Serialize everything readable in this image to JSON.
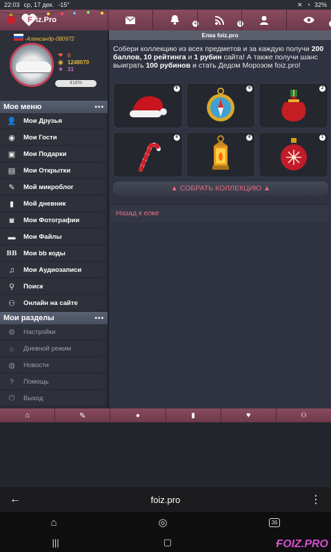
{
  "status_bar": {
    "time": "22:03",
    "date": "ср, 17 дек.",
    "temp": "-15°",
    "battery": "32%"
  },
  "app": {
    "logo_text": "iz.Pro",
    "logo_letter": "F"
  },
  "top_nav": {
    "items": [
      {
        "icon": "mail-icon",
        "badge": ""
      },
      {
        "icon": "bell-icon",
        "badge": "4"
      },
      {
        "icon": "rss-icon",
        "badge": "6"
      },
      {
        "icon": "user-icon",
        "badge": ""
      },
      {
        "icon": "eye-icon",
        "badge": "3"
      }
    ]
  },
  "profile": {
    "username": "-Александр-080972",
    "heart_count": "0",
    "coins": "1248070",
    "rating": "31",
    "progress_label": "416%",
    "progress_fraction": 1.0
  },
  "my_menu": {
    "title": "Мое меню",
    "items": [
      {
        "label": "Мои Друзья",
        "icon": "users-icon"
      },
      {
        "label": "Мои Гости",
        "icon": "eye-icon"
      },
      {
        "label": "Мои Подарки",
        "icon": "gift-icon"
      },
      {
        "label": "Мои Открытки",
        "icon": "postcard-icon"
      },
      {
        "label": "Мой микроблог",
        "icon": "edit-icon"
      },
      {
        "label": "Мой дневник",
        "icon": "book-icon"
      },
      {
        "label": "Мои Фотографии",
        "icon": "camera-icon"
      },
      {
        "label": "Мои Файлы",
        "icon": "folder-icon"
      },
      {
        "label": "Мои bb коды",
        "icon": "bb-icon"
      },
      {
        "label": "Мои Аудиозаписи",
        "icon": "music-icon"
      },
      {
        "label": "Поиск",
        "icon": "search-icon"
      },
      {
        "label": "Онлайн на сайте",
        "icon": "online-icon"
      }
    ]
  },
  "my_sections": {
    "title": "Мои разделы",
    "items": [
      {
        "label": "Настройки",
        "icon": "gear-icon"
      },
      {
        "label": "Дневной режим",
        "icon": "sun-icon"
      },
      {
        "label": "Новости",
        "icon": "globe-icon"
      },
      {
        "label": "Помощь",
        "icon": "help-icon"
      },
      {
        "label": "Выход",
        "icon": "power-icon"
      }
    ]
  },
  "main": {
    "title": "Елка foiz.pro",
    "desc_parts": {
      "a": "Собери коллекцию из всех предметов и за каждую получи ",
      "b": "200 баллов, 10 рейтинга",
      "c": " и ",
      "d": "1 рубин",
      "e": " сайта! А также получи шанс выиграть ",
      "f": "100 рубинов",
      "g": " и стать Дедом Морозом foiz.pro!"
    },
    "items": [
      {
        "name": "santa-hat",
        "count": "6"
      },
      {
        "name": "compass",
        "count": "6"
      },
      {
        "name": "gift-sack",
        "count": "2"
      },
      {
        "name": "candy-cane",
        "count": "4"
      },
      {
        "name": "lantern",
        "count": "6"
      },
      {
        "name": "ornament",
        "count": "1"
      }
    ],
    "collect_label": "СОБРАТЬ КОЛЛЕКЦИЮ",
    "back_label": "Назад к елке"
  },
  "bottom_nav": [
    "home-icon",
    "pencil-icon",
    "chat-icon",
    "book-icon",
    "heart-icon",
    "group-icon"
  ],
  "browser": {
    "url": "foiz.pro",
    "tabs_count": "36"
  },
  "watermark": "FOIZ.PRO"
}
